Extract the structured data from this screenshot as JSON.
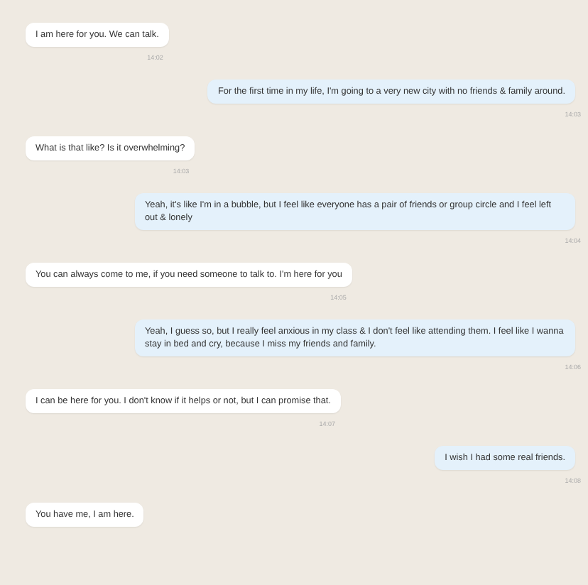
{
  "messages": [
    {
      "kind": "received",
      "text": "I am here for you. We can talk.",
      "time": "14:02"
    },
    {
      "kind": "sent",
      "text": "For the first time in my life, I'm going to a very new city with no friends & family around.",
      "time": "14:03"
    },
    {
      "kind": "received",
      "text": "What is that like? Is it overwhelming?",
      "time": "14:03"
    },
    {
      "kind": "sent",
      "text": "Yeah, it's like I'm in a bubble, but I feel like everyone has a pair of friends or group circle and I feel left out & lonely",
      "time": "14:04"
    },
    {
      "kind": "received",
      "text": "You can always come to me, if you need someone to talk to. I'm here for you",
      "time": "14:05"
    },
    {
      "kind": "sent",
      "text": "Yeah, I guess so, but I really feel anxious in my class & I don't feel like attending them. I feel like I wanna stay in bed and cry, because I miss my friends and family.",
      "time": "14:06"
    },
    {
      "kind": "received",
      "text": "I can be here for you. I don't know if it helps or not, but I can promise that.",
      "time": "14:07"
    },
    {
      "kind": "sent",
      "text": "I wish I had some real friends.",
      "time": "14:08"
    },
    {
      "kind": "received",
      "text": "You have me, I am here."
    }
  ]
}
